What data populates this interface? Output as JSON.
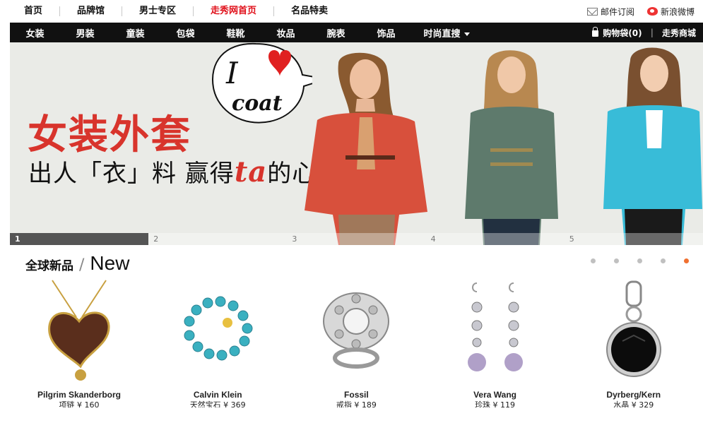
{
  "top_nav": {
    "items": [
      {
        "label": "首页"
      },
      {
        "label": "品牌馆"
      },
      {
        "label": "男士专区"
      },
      {
        "label": "走秀网首页",
        "active": true
      },
      {
        "label": "名品特卖"
      }
    ],
    "mail_label": "邮件订阅",
    "weibo_label": "新浪微博"
  },
  "category_nav": {
    "items": [
      "女装",
      "男装",
      "童装",
      "包袋",
      "鞋靴",
      "妆品",
      "腕表",
      "饰品"
    ],
    "dropdown_label": "时尚直搜",
    "cart_label": "购物袋(0)",
    "mall_label": "走秀商城"
  },
  "banner": {
    "headline": "女装外套",
    "sub_part1": "出人「衣」料 赢得",
    "sub_ta": "ta",
    "sub_part2": "的心",
    "bubble_i": "I",
    "bubble_coat": "coat",
    "slides": [
      "1",
      "2",
      "3",
      "4",
      "5"
    ],
    "active_slide": 0
  },
  "new_section": {
    "title_cn": "全球新品",
    "slash": "/",
    "title_en": "New",
    "pager_count": 5,
    "pager_active": 4
  },
  "products": [
    {
      "brand": "Pilgrim Skanderborg",
      "meta": "项链 ¥ 160"
    },
    {
      "brand": "Calvin Klein",
      "meta": "天然宝石 ¥ 369"
    },
    {
      "brand": "Fossil",
      "meta": "戒指 ¥ 189"
    },
    {
      "brand": "Vera Wang",
      "meta": "珍珠 ¥ 119"
    },
    {
      "brand": "Dyrberg/Kern",
      "meta": "水晶 ¥ 329"
    }
  ],
  "colors": {
    "accent_red": "#e0101a",
    "nav_black": "#111111",
    "pager_active": "#f07030",
    "banner_bg": "#eaebe7"
  }
}
